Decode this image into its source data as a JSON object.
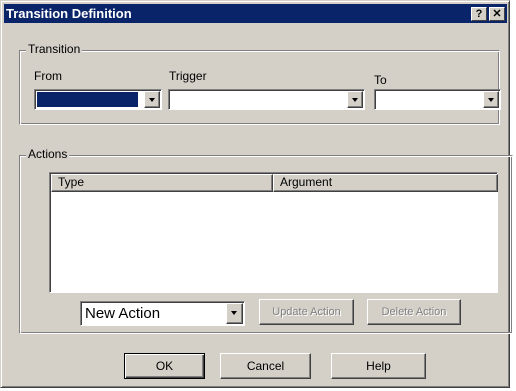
{
  "dialog": {
    "title": "Transition Definition",
    "help_label": "?",
    "close_label": "✕"
  },
  "transition": {
    "group_label": "Transition",
    "from_label": "From",
    "trigger_label": "Trigger",
    "to_label": "To",
    "from_value": "",
    "trigger_value": "",
    "to_value": ""
  },
  "actions": {
    "group_label": "Actions",
    "columns": [
      "Type",
      "Argument"
    ],
    "rows": [],
    "new_action_value": "New Action",
    "update_label": "Update Action",
    "delete_label": "Delete Action"
  },
  "buttons": {
    "ok": "OK",
    "cancel": "Cancel",
    "help": "Help"
  },
  "colors": {
    "face": "#d4d0c8",
    "titlebar": "#0a246a",
    "selection": "#0a246a"
  },
  "icons": {
    "dropdown": "chevron-down-icon",
    "help": "question-mark-icon",
    "close": "close-icon"
  }
}
